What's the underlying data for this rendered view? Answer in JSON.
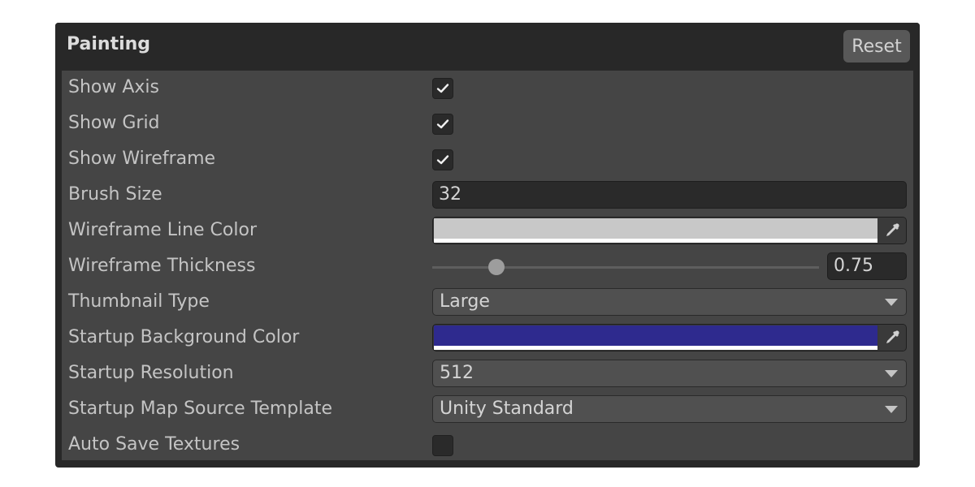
{
  "panel": {
    "title": "Painting",
    "reset_label": "Reset"
  },
  "fields": {
    "show_axis": {
      "label": "Show Axis",
      "checked": true
    },
    "show_grid": {
      "label": "Show Grid",
      "checked": true
    },
    "show_wireframe": {
      "label": "Show Wireframe",
      "checked": true
    },
    "brush_size": {
      "label": "Brush Size",
      "value": "32"
    },
    "wireframe_line_color": {
      "label": "Wireframe Line Color",
      "color": "#c8c8c8",
      "icon": "eyedropper-icon"
    },
    "wireframe_thickness": {
      "label": "Wireframe Thickness",
      "value": "0.75",
      "slider_fraction": 0.165
    },
    "thumbnail_type": {
      "label": "Thumbnail Type",
      "value": "Large"
    },
    "startup_background_color": {
      "label": "Startup Background Color",
      "color": "#2e2a8e",
      "icon": "eyedropper-icon"
    },
    "startup_resolution": {
      "label": "Startup Resolution",
      "value": "512"
    },
    "startup_map_source_template": {
      "label": "Startup Map Source Template",
      "value": "Unity Standard"
    },
    "auto_save_textures": {
      "label": "Auto Save Textures",
      "checked": false
    }
  }
}
